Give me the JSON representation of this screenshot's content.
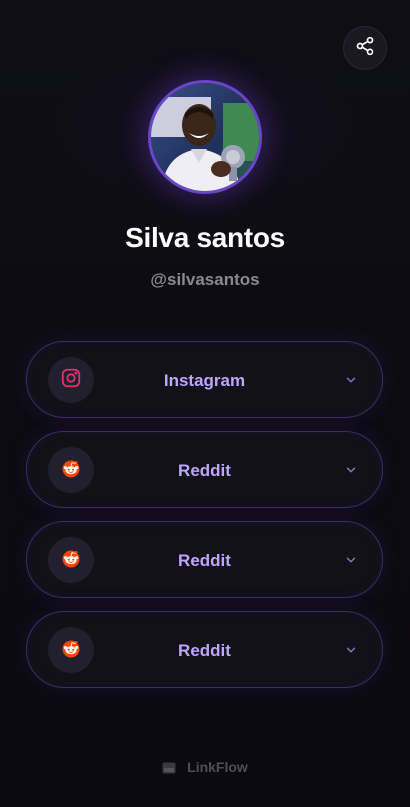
{
  "profile": {
    "name": "Silva santos",
    "handle": "@silvasantos",
    "avatar_alt": "Profile photo"
  },
  "share": {
    "icon": "share-icon"
  },
  "links": [
    {
      "label": "Instagram",
      "icon": "instagram-icon",
      "icon_color": "#e1306c"
    },
    {
      "label": "Reddit",
      "icon": "reddit-icon",
      "icon_color": "#ff4500"
    },
    {
      "label": "Reddit",
      "icon": "reddit-icon",
      "icon_color": "#ff4500"
    },
    {
      "label": "Reddit",
      "icon": "reddit-icon",
      "icon_color": "#ff4500"
    }
  ],
  "footer": {
    "brand": "LinkFlow"
  },
  "colors": {
    "background": "#0c0b11",
    "accent": "#bda6ff",
    "card_border": "#3a2d6a",
    "avatar_ring": "#6b46c9"
  }
}
